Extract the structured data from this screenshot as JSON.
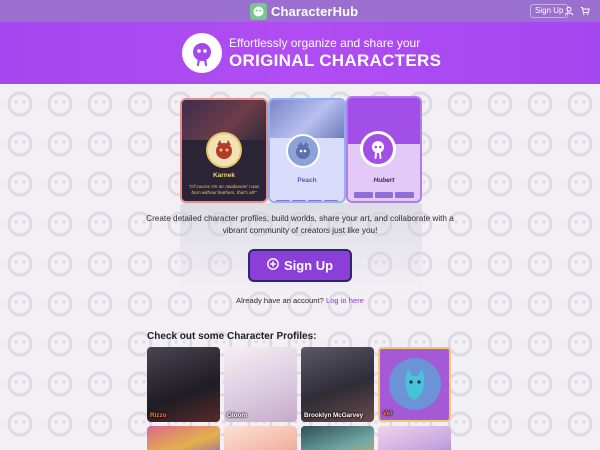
{
  "nav": {
    "brand_name": "CharacterHub",
    "signup_label": "Sign Up",
    "icons": [
      "user-icon",
      "cart-icon"
    ]
  },
  "hero": {
    "tagline": "Effortlessly organize and share your",
    "headline": "ORIGINAL CHARACTERS"
  },
  "showcase": {
    "cards": [
      {
        "name": "Karnek",
        "quote": "\"Of course I'm an Awakeone! I was born without feathers, that's all!\"",
        "border": "#e78c8c"
      },
      {
        "name": "Peach",
        "border": "#8db4ef"
      },
      {
        "name": "Hubert",
        "border": "#b07ee6"
      }
    ]
  },
  "main": {
    "description": "Create detailed character profiles, build worlds, share your art, and collaborate with a vibrant community of creators just like you!",
    "cta_label": "Sign Up",
    "login_prompt": "Already have an account?",
    "login_link": "Log in here"
  },
  "profiles": {
    "title": "Check out some Character Profiles:",
    "row1": [
      {
        "name": "Rizzo",
        "color": "#2a2a33"
      },
      {
        "name": "Gloom",
        "color": "#e8dfe9"
      },
      {
        "name": "Brooklyn McGarvey",
        "color": "#3b3b47"
      },
      {
        "name": "Vel",
        "color": "#a45ad6"
      }
    ],
    "row2": [
      {
        "color": "#d96a8e"
      },
      {
        "color": "#f3b9a8"
      },
      {
        "color": "#6fa6a4"
      },
      {
        "color": "#c8a6e0"
      }
    ]
  },
  "colors": {
    "accent": "#8b3fd9",
    "hero_bg": "#a447f0",
    "nav_bg": "#9a6fcf"
  }
}
